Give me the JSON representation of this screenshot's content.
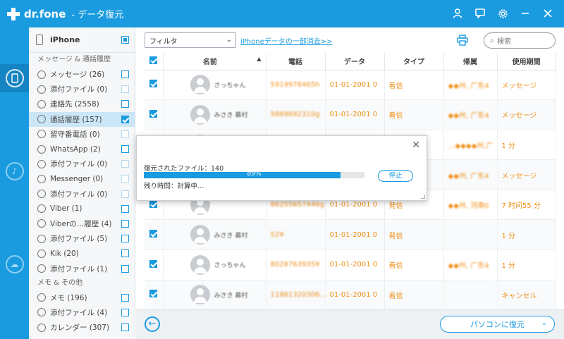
{
  "app": {
    "brand": "dr.fone",
    "title": "- データ復元"
  },
  "titlebar_icons": [
    "user-icon",
    "chat-icon",
    "gear-icon",
    "minimize-icon",
    "close-icon"
  ],
  "device": {
    "name": "iPhone"
  },
  "sidebar": {
    "section1": "メッセージ & 通話履歴",
    "section2": "メモ & その他",
    "items_a": [
      {
        "label": "メッセージ (26)",
        "icon": "message-icon",
        "check": "empty"
      },
      {
        "label": "添付ファイル (0)",
        "icon": "attachment-icon",
        "check": "dim"
      },
      {
        "label": "連絡先 (2558)",
        "icon": "contact-icon",
        "check": "empty"
      },
      {
        "label": "通話履歴 (157)",
        "icon": "call-icon",
        "check": "checked"
      },
      {
        "label": "留守番電話 (0)",
        "icon": "voicemail-icon",
        "check": "dim"
      },
      {
        "label": "WhatsApp (2)",
        "icon": "whatsapp-icon",
        "check": "empty"
      },
      {
        "label": "添付ファイル (0)",
        "icon": "attachment-icon",
        "check": "dim"
      },
      {
        "label": "Messenger (0)",
        "icon": "messenger-icon",
        "check": "dim"
      },
      {
        "label": "添付ファイル (0)",
        "icon": "attachment-icon",
        "check": "dim"
      },
      {
        "label": "Viber (1)",
        "icon": "viber-icon",
        "check": "empty"
      },
      {
        "label": "Viberの…履歴 (4)",
        "icon": "viber-icon",
        "check": "empty"
      },
      {
        "label": "添付ファイル (5)",
        "icon": "attachment-icon",
        "check": "empty"
      },
      {
        "label": "Kik (20)",
        "icon": "kik-icon",
        "check": "empty"
      },
      {
        "label": "添付ファイル (1)",
        "icon": "attachment-icon",
        "check": "empty"
      }
    ],
    "items_b": [
      {
        "label": "メモ (196)",
        "icon": "memo-icon",
        "check": "empty"
      },
      {
        "label": "添付ファイル (4)",
        "icon": "attachment-icon",
        "check": "empty"
      },
      {
        "label": "カレンダー (307)",
        "icon": "calendar-icon",
        "check": "empty"
      }
    ]
  },
  "toolbar": {
    "filter": "フィルタ",
    "erase_link": "iPhoneデータの一部消去>>",
    "search_placeholder": "検索"
  },
  "table": {
    "headers": [
      "名前",
      "電話",
      "データ",
      "タイプ",
      "帰属",
      "使用期間"
    ],
    "rows": [
      {
        "name": "さっちゃん",
        "phone": "5919978465h",
        "date": "01-01-2001 0",
        "type": "着信",
        "place": "◆◆州, 广东4",
        "duration": "メッセージ"
      },
      {
        "name": "みさき 幕村",
        "phone": "5889692310g",
        "date": "01-01-2001 0",
        "type": "着信",
        "place": "◆◆州, 广东4",
        "duration": "メッセージ"
      },
      {
        "name": "",
        "phone": "",
        "date": "",
        "type": "",
        "place": "…◆◆◆◆州,广",
        "duration": "1 分"
      },
      {
        "name": "",
        "phone": "",
        "date": "",
        "type": "",
        "place": "◆◆州, 广东4",
        "duration": "メッセージ"
      },
      {
        "name": "",
        "phone": "86255657446g",
        "date": "01-01-2001 0",
        "type": "発信",
        "place": "◆◆州, 河南0",
        "duration": "7 时间55 分"
      },
      {
        "name": "みさき 幕村",
        "phone": "52¥",
        "date": "01-01-2001 0",
        "type": "発信",
        "place": "",
        "duration": "1 分"
      },
      {
        "name": "さっちゃん",
        "phone": "8028763935¥",
        "date": "01-01-2001 0",
        "type": "着信",
        "place": "◆◆州, 广东4",
        "duration": "1 分"
      },
      {
        "name": "みさき 幕村",
        "phone": "11861320306…",
        "date": "01-01-2001 0",
        "type": "着信",
        "place": "",
        "duration": "キャンセル"
      }
    ]
  },
  "dialog": {
    "recovered": "復元されたファイル：140",
    "progress": 0.89,
    "progress_text": "89%",
    "remaining": "残り時間：計算中…",
    "stop": "停止"
  },
  "footer": {
    "restore": "パソコンに復元"
  }
}
